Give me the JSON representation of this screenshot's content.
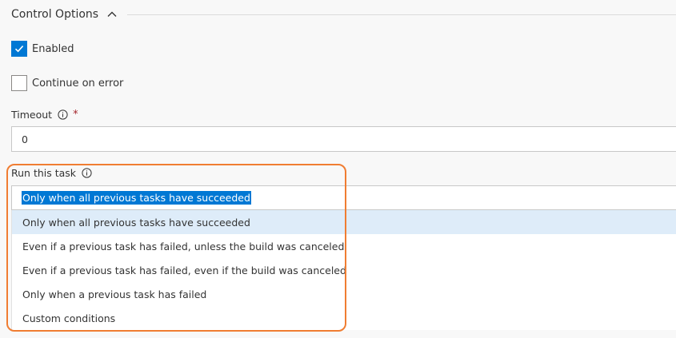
{
  "section": {
    "title": "Control Options",
    "collapse_icon": "chevron-up-icon"
  },
  "enabled": {
    "label": "Enabled",
    "checked": true
  },
  "continue_on_error": {
    "label": "Continue on error",
    "checked": false
  },
  "timeout": {
    "label": "Timeout",
    "required_marker": "*",
    "value": "0",
    "info_icon": "info-icon"
  },
  "run_task": {
    "label": "Run this task",
    "info_icon": "info-icon",
    "selected_value": "Only when all previous tasks have succeeded",
    "options": [
      "Only when all previous tasks have succeeded",
      "Even if a previous task has failed, unless the build was canceled",
      "Even if a previous task has failed, even if the build was canceled",
      "Only when a previous task has failed",
      "Custom conditions"
    ]
  },
  "colors": {
    "accent": "#0078d4",
    "highlight_border": "#f07d32",
    "option_hover": "#deecf9",
    "required": "#a4262c"
  }
}
